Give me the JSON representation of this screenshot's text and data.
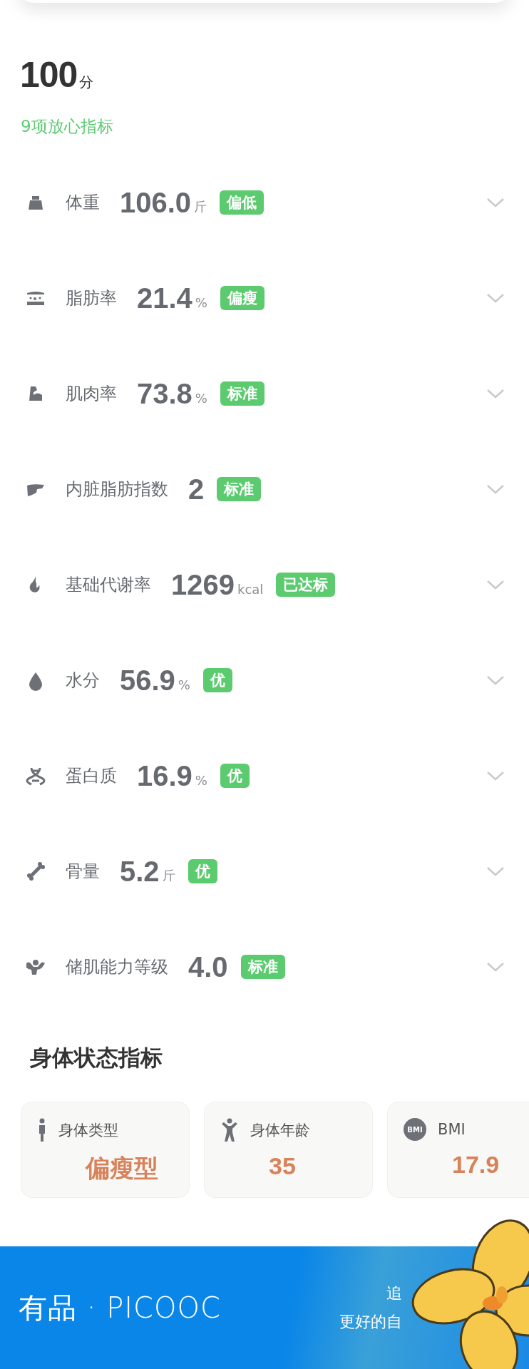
{
  "score": {
    "value": "100",
    "unit": "分"
  },
  "summary": "9项放心指标",
  "metrics": [
    {
      "kind": "weight",
      "label": "体重",
      "value": "106.0",
      "unit": "斤",
      "status": "偏低"
    },
    {
      "kind": "fat",
      "label": "脂肪率",
      "value": "21.4",
      "unit": "%",
      "status": "偏瘦"
    },
    {
      "kind": "muscle",
      "label": "肌肉率",
      "value": "73.8",
      "unit": "%",
      "status": "标准"
    },
    {
      "kind": "liver",
      "label": "内脏脂肪指数",
      "value": "2",
      "status": "标准"
    },
    {
      "kind": "flame",
      "label": "基础代谢率",
      "value": "1269",
      "unit": "kcal",
      "status": "已达标"
    },
    {
      "kind": "drop",
      "label": "水分",
      "value": "56.9",
      "unit": "%",
      "status": "优"
    },
    {
      "kind": "dna",
      "label": "蛋白质",
      "value": "16.9",
      "unit": "%",
      "status": "优"
    },
    {
      "kind": "bone",
      "label": "骨量",
      "value": "5.2",
      "unit": "斤",
      "status": "优"
    },
    {
      "kind": "torso",
      "label": "储肌能力等级",
      "value": "4.0",
      "status": "标准"
    }
  ],
  "body_status": {
    "title": "身体状态指标",
    "cards": [
      {
        "kind": "figure",
        "label": "身体类型",
        "value": "偏瘦型"
      },
      {
        "kind": "person",
        "label": "身体年龄",
        "value": "35"
      },
      {
        "kind": "bmi",
        "icon_text": "BMI",
        "label": "BMI",
        "value": "17.9"
      }
    ]
  },
  "footer": {
    "brand": "有品 · PICOOC",
    "slogan": [
      "追",
      "更好的自"
    ]
  }
}
